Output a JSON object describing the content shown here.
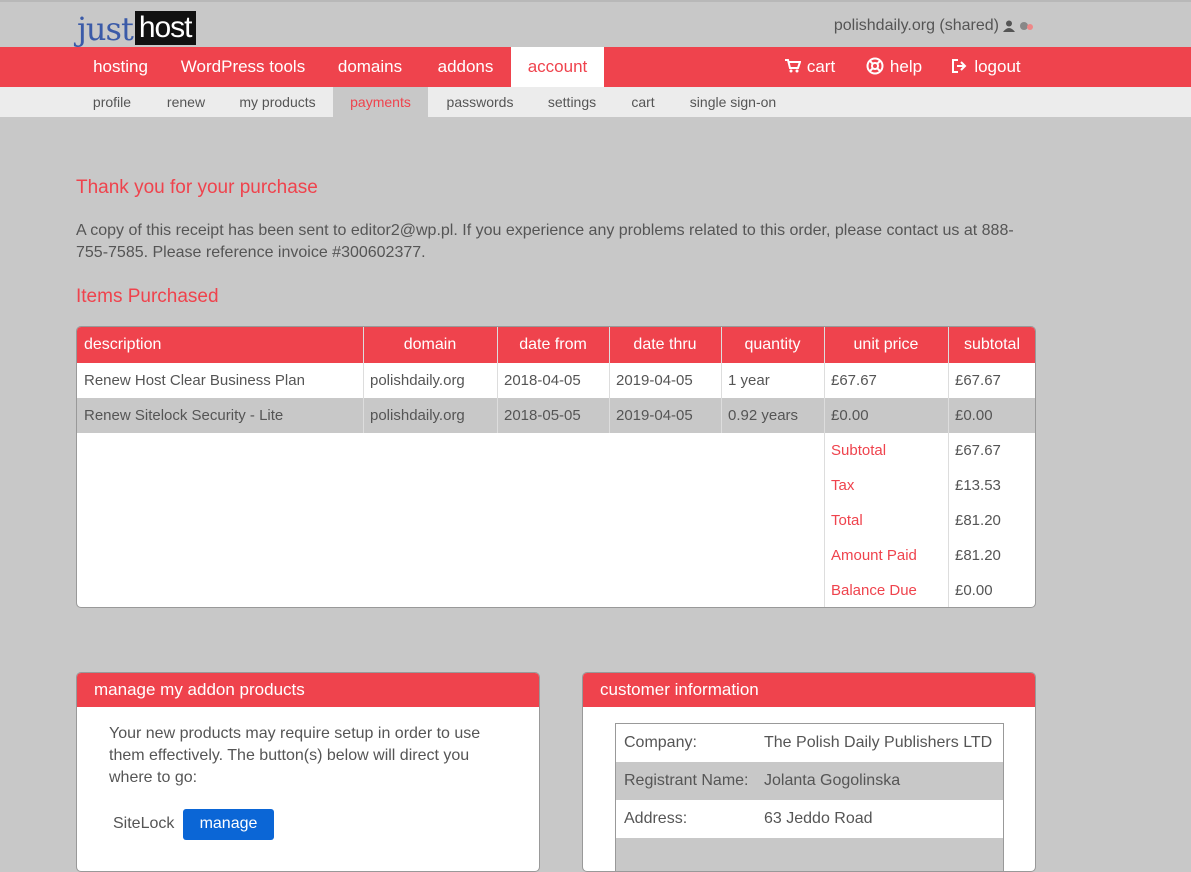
{
  "header": {
    "logo_part1": "just",
    "logo_part2": "host",
    "account_label": "polishdaily.org (shared)"
  },
  "nav": {
    "items": [
      "hosting",
      "WordPress tools",
      "domains",
      "addons",
      "account"
    ],
    "right": [
      "cart",
      "help",
      "logout"
    ],
    "active": "account"
  },
  "subnav": {
    "items": [
      "profile",
      "renew",
      "my products",
      "payments",
      "passwords",
      "settings",
      "cart",
      "single sign-on"
    ],
    "active": "payments"
  },
  "thanks_heading": "Thank you for your purchase",
  "receipt_text": "A copy of this receipt has been sent to editor2@wp.pl. If you experience any problems related to this order, please contact us at 888-755-7585. Please reference invoice #300602377.",
  "items_heading": "Items Purchased",
  "table": {
    "headers": [
      "description",
      "domain",
      "date from",
      "date thru",
      "quantity",
      "unit price",
      "subtotal"
    ],
    "rows": [
      [
        "Renew Host Clear Business Plan",
        "polishdaily.org",
        "2018-04-05",
        "2019-04-05",
        "1 year",
        "£67.67",
        "£67.67"
      ],
      [
        "Renew Sitelock Security - Lite",
        "polishdaily.org",
        "2018-05-05",
        "2019-04-05",
        "0.92 years",
        "£0.00",
        "£0.00"
      ]
    ],
    "totals": [
      {
        "label": "Subtotal",
        "value": "£67.67"
      },
      {
        "label": "Tax",
        "value": "£13.53"
      },
      {
        "label": "Total",
        "value": "£81.20"
      },
      {
        "label": "Amount Paid",
        "value": "£81.20"
      },
      {
        "label": "Balance Due",
        "value": "£0.00"
      }
    ]
  },
  "addon_panel": {
    "title": "manage my addon products",
    "text": "Your new products may require setup in order to use them effectively. The button(s) below will direct you where to go:",
    "product": "SiteLock",
    "button": "manage"
  },
  "customer_panel": {
    "title": "customer information",
    "rows": [
      {
        "key": "Company:",
        "value": "The Polish Daily Publishers LTD"
      },
      {
        "key": "Registrant Name:",
        "value": "Jolanta Gogolinska"
      },
      {
        "key": "Address:",
        "value": "63 Jeddo Road"
      }
    ]
  },
  "colors": {
    "brand_red": "#ef434d",
    "button_blue": "#0b66d6",
    "background": "#c8c8c8"
  }
}
